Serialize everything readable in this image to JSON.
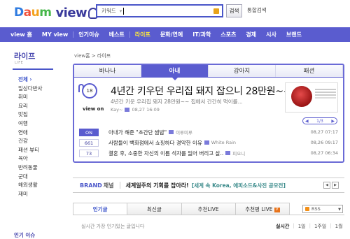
{
  "header": {
    "logo_daum": "Daum",
    "logo_view": "view",
    "search_placeholder": "키워드",
    "search_button": "검색",
    "total_search": "통합검색"
  },
  "nav": {
    "items": [
      {
        "label": "view 홈",
        "active": false
      },
      {
        "label": "MY view",
        "active": false
      },
      {
        "label": "인기이슈",
        "active": false
      },
      {
        "label": "베스트",
        "active": false
      },
      {
        "label": "라이프",
        "active": true
      },
      {
        "label": "문화/연예",
        "active": false
      },
      {
        "label": "IT/과학",
        "active": false
      },
      {
        "label": "스포츠",
        "active": false
      },
      {
        "label": "경제",
        "active": false
      },
      {
        "label": "시사",
        "active": false
      },
      {
        "label": "브랜드",
        "active": false
      }
    ]
  },
  "sidebar": {
    "title": "라이프",
    "subtitle": "LIFE",
    "items": [
      "전체",
      "일상다반사",
      "취미",
      "요리",
      "맛집",
      "여행",
      "연애",
      "건강",
      "패션 뷰티",
      "육아",
      "반려동물",
      "군대",
      "해외생활",
      "재미"
    ],
    "active_index": 0,
    "bottom_label": "인기 이슈"
  },
  "breadcrumb": {
    "home": "view홈",
    "sep": ">",
    "current": "라이프"
  },
  "tabs": [
    {
      "label": "바나나",
      "active": false
    },
    {
      "label": "아내",
      "active": true
    },
    {
      "label": "강아지",
      "active": false
    },
    {
      "label": "패션",
      "active": false
    }
  ],
  "featured": {
    "votes": "18",
    "view_on": "view on",
    "title": "4년간 키우던 우리집 돼지 잡으니 28만원~~",
    "desc": "4년간 키운 우리집 돼지 28만원~~ 집에서 간간히 먹이를...",
    "author": "Kay~",
    "date": "08,27 16:09",
    "pager": "1/3"
  },
  "list": [
    {
      "count": "ON",
      "title": "아내가 해준 \"초간단 쌈밥\"",
      "author": "이루미루",
      "date": "08,27 07:17",
      "on": true
    },
    {
      "count": "661",
      "title": "사람들이 백화점에서 쇼핑하다 경악한 이유",
      "author": "White Rain",
      "date": "08,26 09:17",
      "on": false
    },
    {
      "count": "73",
      "title": "결혼 후, 소중한 자신의 이름 석자를 잃어 버리고 살..",
      "author": "피오니",
      "date": "08,27 06:34",
      "on": false
    }
  ],
  "brand": {
    "label": "BRAND",
    "label2": "채널",
    "text": "세계일주의 기회를 잡아라!",
    "link": "[세계 속 Korea, 에피소드&사진 공모전]",
    "prev": "◀",
    "next": "▶"
  },
  "bottom_tabs": [
    {
      "label": "인기글",
      "active": true
    },
    {
      "label": "최신글",
      "active": false
    },
    {
      "label": "추천LIVE",
      "active": false
    },
    {
      "label": "추천평 LIVE",
      "active": false
    }
  ],
  "rss_label": "RSS",
  "bottom_desc": "실시간 가장 인기있는 글입니다",
  "period": [
    {
      "label": "실시간",
      "active": true
    },
    {
      "label": "1일",
      "active": false
    },
    {
      "label": "1주일",
      "active": false
    },
    {
      "label": "1월",
      "active": false
    }
  ],
  "colors": {
    "brand_blue": "#5a5ccf",
    "accent_yellow": "#ffea3a"
  }
}
